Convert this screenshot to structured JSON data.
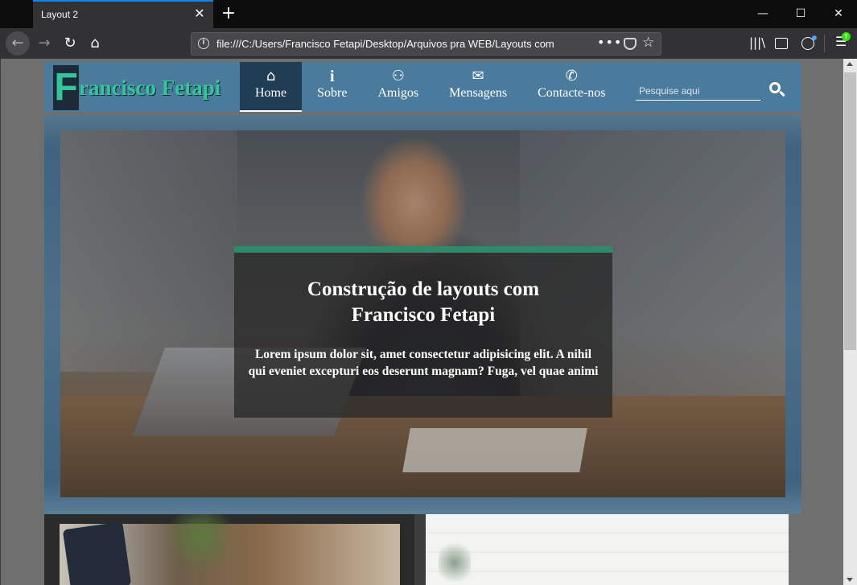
{
  "browser": {
    "tab_title": "Layout 2",
    "tab_close": "✕",
    "new_tab": "+",
    "url": "file:///C:/Users/Francisco Fetapi/Desktop/Arquivos pra WEB/Layouts com",
    "page_actions": "•••"
  },
  "site": {
    "logo_initial": "F",
    "logo_rest": "rancisco Fetapi",
    "menu": [
      {
        "label": "Home",
        "icon": "home-icon",
        "active": true
      },
      {
        "label": "Sobre",
        "icon": "info-icon",
        "active": false
      },
      {
        "label": "Amigos",
        "icon": "users-icon",
        "active": false
      },
      {
        "label": "Mensagens",
        "icon": "envelope-icon",
        "active": false
      },
      {
        "label": "Contacte-nos",
        "icon": "phone-icon",
        "active": false
      }
    ],
    "search_placeholder": "Pesquise aqui"
  },
  "hero": {
    "title": "Construção de layouts com Francisco Fetapi",
    "text": "Lorem ipsum dolor sit, amet consectetur adipisicing elit. A nihil qui eveniet excepturi eos deserunt magnam? Fuga, vel quae animi"
  },
  "colors": {
    "header_bg": "#4b7b9c",
    "active_menu_bg": "#1f3d55",
    "logo_text": "#34c59b",
    "caption_accent": "#2f8a6a"
  }
}
